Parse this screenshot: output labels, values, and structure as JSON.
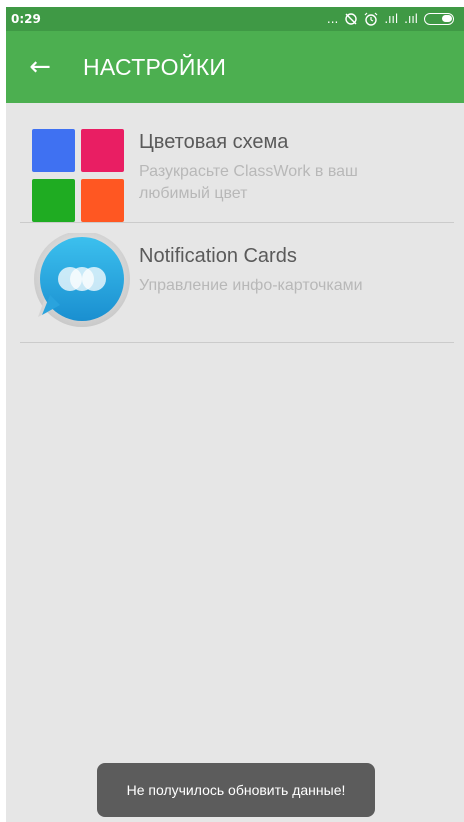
{
  "status_bar": {
    "time": "0:29",
    "icons": [
      "more-dots-icon",
      "sync-off-icon",
      "alarm-icon",
      "signal-icon",
      "signal-icon",
      "battery-icon"
    ],
    "more_glyph": "...",
    "signal_glyph": ".ııl"
  },
  "app_bar": {
    "title": "НАСТРОЙКИ",
    "back_icon": "←",
    "color": "#4caf50"
  },
  "settings": [
    {
      "title": "Цветовая схема",
      "subtitle": "Разукрасьте ClassWork в ваш любимый цвет",
      "icon": "color-palette-icon",
      "palette_colors": [
        "#3f71f2",
        "#e91e63",
        "#1fac22",
        "#ff5722"
      ]
    },
    {
      "title": "Notification Cards",
      "subtitle": "Управление инфо-карточками",
      "icon": "chat-bubble-icon"
    }
  ],
  "toast": {
    "message": "Не получилось обновить данные!"
  }
}
